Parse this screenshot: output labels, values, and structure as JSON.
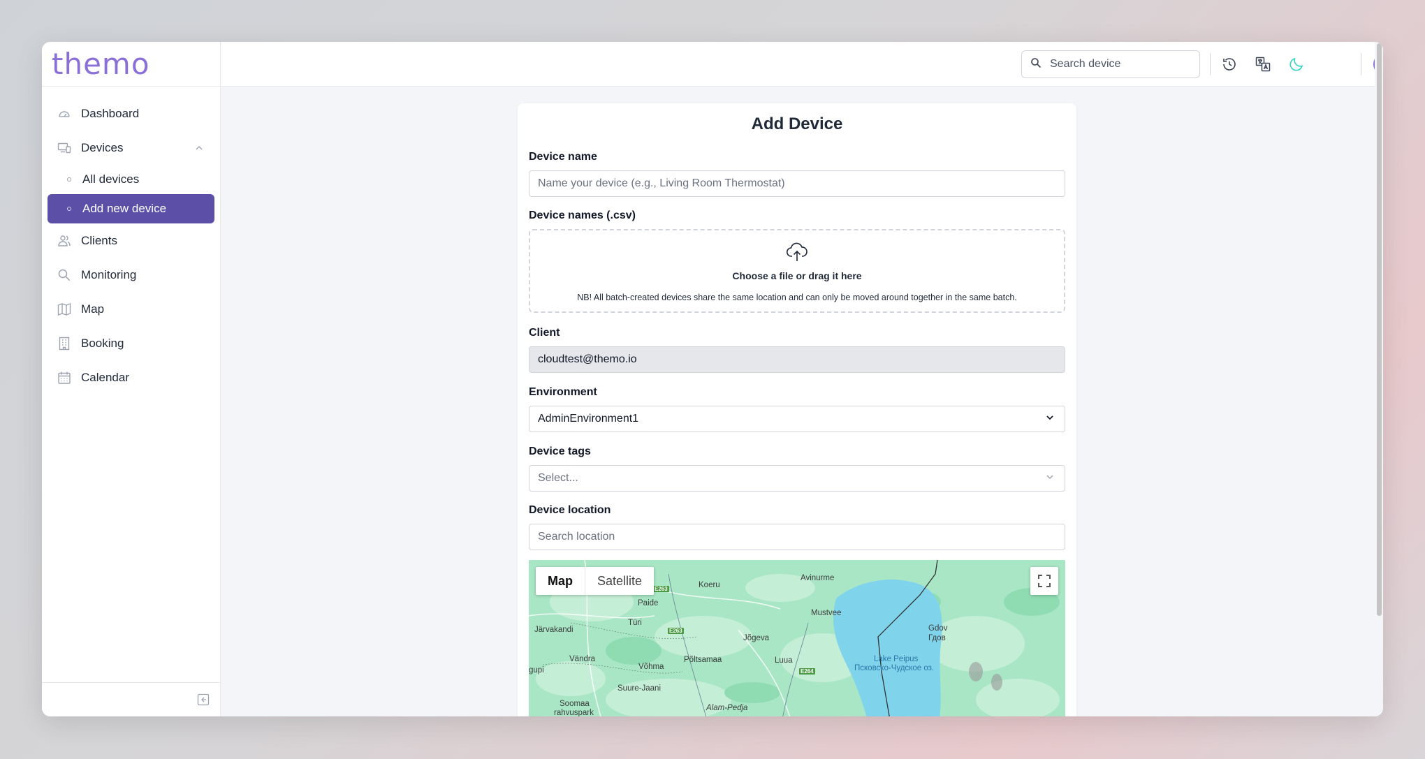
{
  "app": {
    "logo": "themo"
  },
  "sidebar": {
    "items": [
      {
        "label": "Dashboard",
        "icon": "gauge-icon"
      },
      {
        "label": "Devices",
        "icon": "devices-icon"
      },
      {
        "label": "Clients",
        "icon": "users-icon"
      },
      {
        "label": "Monitoring",
        "icon": "search-icon"
      },
      {
        "label": "Map",
        "icon": "map-icon"
      },
      {
        "label": "Booking",
        "icon": "building-icon"
      },
      {
        "label": "Calendar",
        "icon": "calendar-icon"
      }
    ],
    "devices_sub": [
      {
        "label": "All devices",
        "active": false
      },
      {
        "label": "Add new device",
        "active": true
      }
    ]
  },
  "header": {
    "search_placeholder": "Search device",
    "icons": [
      "history-icon",
      "translate-icon",
      "moon-icon",
      "user-avatar-icon"
    ]
  },
  "form": {
    "title": "Add Device",
    "device_name": {
      "label": "Device name",
      "placeholder": "Name your device (e.g., Living Room Thermostat)"
    },
    "device_names_csv": {
      "label": "Device names (.csv)",
      "dropzone_title": "Choose a file or drag it here",
      "dropzone_note": "NB! All batch-created devices share the same location and can only be moved around together in the same batch."
    },
    "client": {
      "label": "Client",
      "value": "cloudtest@themo.io"
    },
    "environment": {
      "label": "Environment",
      "value": "AdminEnvironment1"
    },
    "device_tags": {
      "label": "Device tags",
      "placeholder": "Select..."
    },
    "device_location": {
      "label": "Device location",
      "placeholder": "Search location"
    }
  },
  "map": {
    "tabs": [
      "Map",
      "Satellite"
    ],
    "active_tab": "Map",
    "places": {
      "avinurme": "Avinurme",
      "koeru": "Koeru",
      "paide": "Paide",
      "mustvee": "Mustvee",
      "gdov": "Gdov",
      "gdov_ru": "Гдов",
      "jarvakandi": "Järvakandi",
      "turi": "Türi",
      "jogeva": "Jõgeva",
      "lake": "Lake Peipus",
      "lake_ru": "Псковско-Чудское оз.",
      "vandra": "Vändra",
      "vohma": "Võhma",
      "poltsamaa": "Põltsamaa",
      "luua": "Luua",
      "gupi": "gupi",
      "suure_jaani": "Suure-Jaani",
      "soomaa": "Soomaa",
      "soomaa2": "rahvuspark",
      "alam_pedja": "Alam-Pedja"
    },
    "roads": {
      "e263a": "E263",
      "e263b": "E263",
      "e264": "E264"
    }
  },
  "colors": {
    "accent": "#5b4fa8",
    "logo": "#8b6fd9",
    "moon": "#2dd4bf",
    "map_land": "#9fe4c0",
    "map_water": "#7fd4ec"
  }
}
